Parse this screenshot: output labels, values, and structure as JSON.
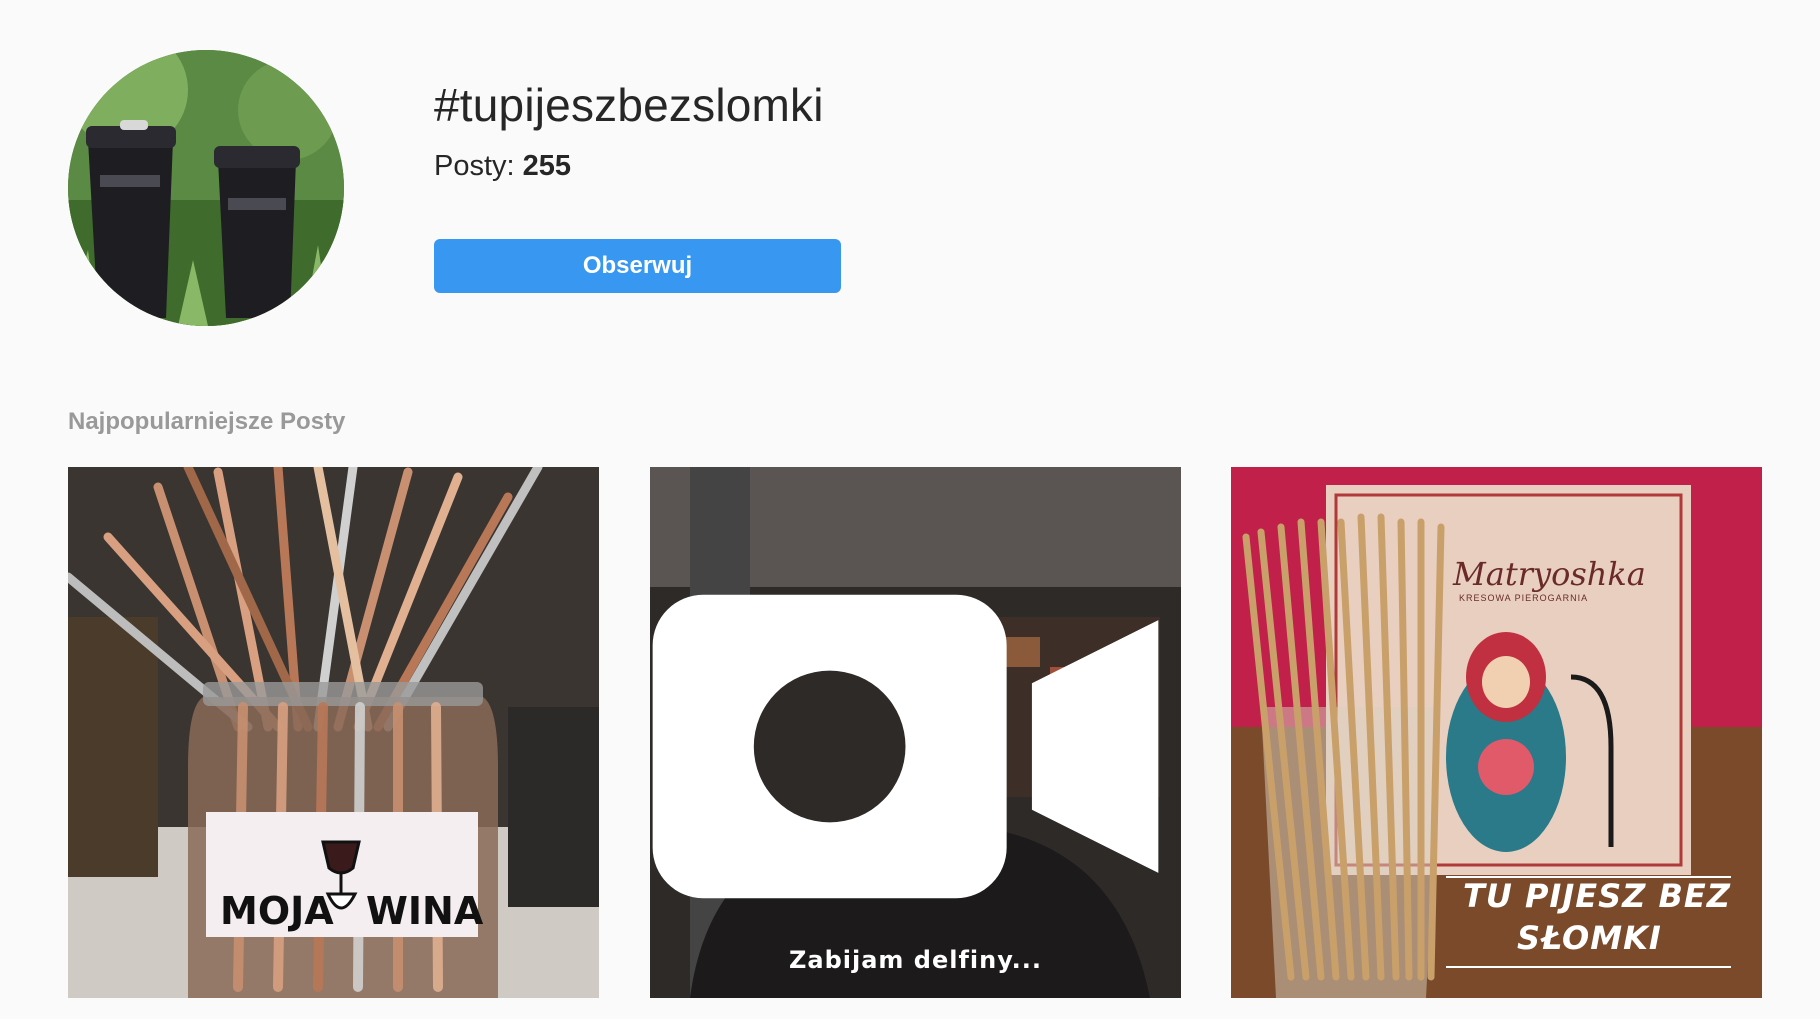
{
  "hashtag": {
    "title": "#tupijeszbezslomki",
    "posts_label": "Posty:",
    "posts_count": "255",
    "follow_label": "Obserwuj"
  },
  "top_posts": {
    "section_title": "Najpopularniejsze Posty",
    "items": [
      {
        "type": "image",
        "jar_text_left": "MOJA",
        "jar_text_right": "WINA"
      },
      {
        "type": "video",
        "icon": "video-camera-icon",
        "caption": "Zabijam delfiny..."
      },
      {
        "type": "image",
        "brand": "Matryoshka",
        "brand_sub": "KRESOWA PIEROGARNIA",
        "slogan_line1": "TU PIJESZ BEZ",
        "slogan_line2": "SŁOMKI"
      }
    ]
  },
  "colors": {
    "background": "#fafafa",
    "follow_button": "#3897f0",
    "section_title": "#999999"
  }
}
